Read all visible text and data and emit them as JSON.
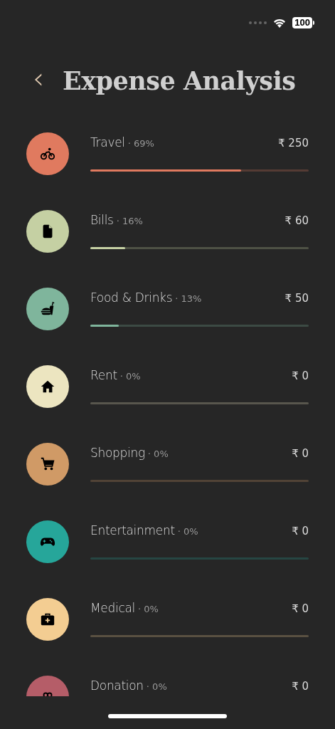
{
  "status_bar": {
    "battery": "100"
  },
  "header": {
    "back": "‹",
    "title": "Expense Analysis"
  },
  "categories": [
    {
      "kind": "bike",
      "name": "Travel",
      "percent": "· 69%",
      "amount": "₹ 250",
      "level": 0.69,
      "color": "#e07a5f"
    },
    {
      "kind": "file",
      "name": "Bills",
      "percent": "· 16%",
      "amount": "₹ 60",
      "level": 0.16,
      "color": "#c5d0a3"
    },
    {
      "kind": "food",
      "name": "Food & Drinks",
      "percent": "· 13%",
      "amount": "₹ 50",
      "level": 0.13,
      "color": "#7fb59c"
    },
    {
      "kind": "house",
      "name": "Rent",
      "percent": "· 0%",
      "amount": "₹ 0",
      "color": "#ece5c0"
    },
    {
      "kind": "cart",
      "name": "Shopping",
      "percent": "· 0%",
      "amount": "₹ 0",
      "color": "#d09a66"
    },
    {
      "kind": "gamepad",
      "name": "Entertainment",
      "percent": "· 0%",
      "amount": "₹ 0",
      "color": "#26a69a"
    },
    {
      "kind": "medkit",
      "name": "Medical",
      "percent": "· 0%",
      "amount": "₹ 0",
      "color": "#f3cd92"
    },
    {
      "kind": "gift",
      "name": "Donation",
      "percent": "· 0%",
      "amount": "₹ 0",
      "color": "#b55d68"
    }
  ]
}
